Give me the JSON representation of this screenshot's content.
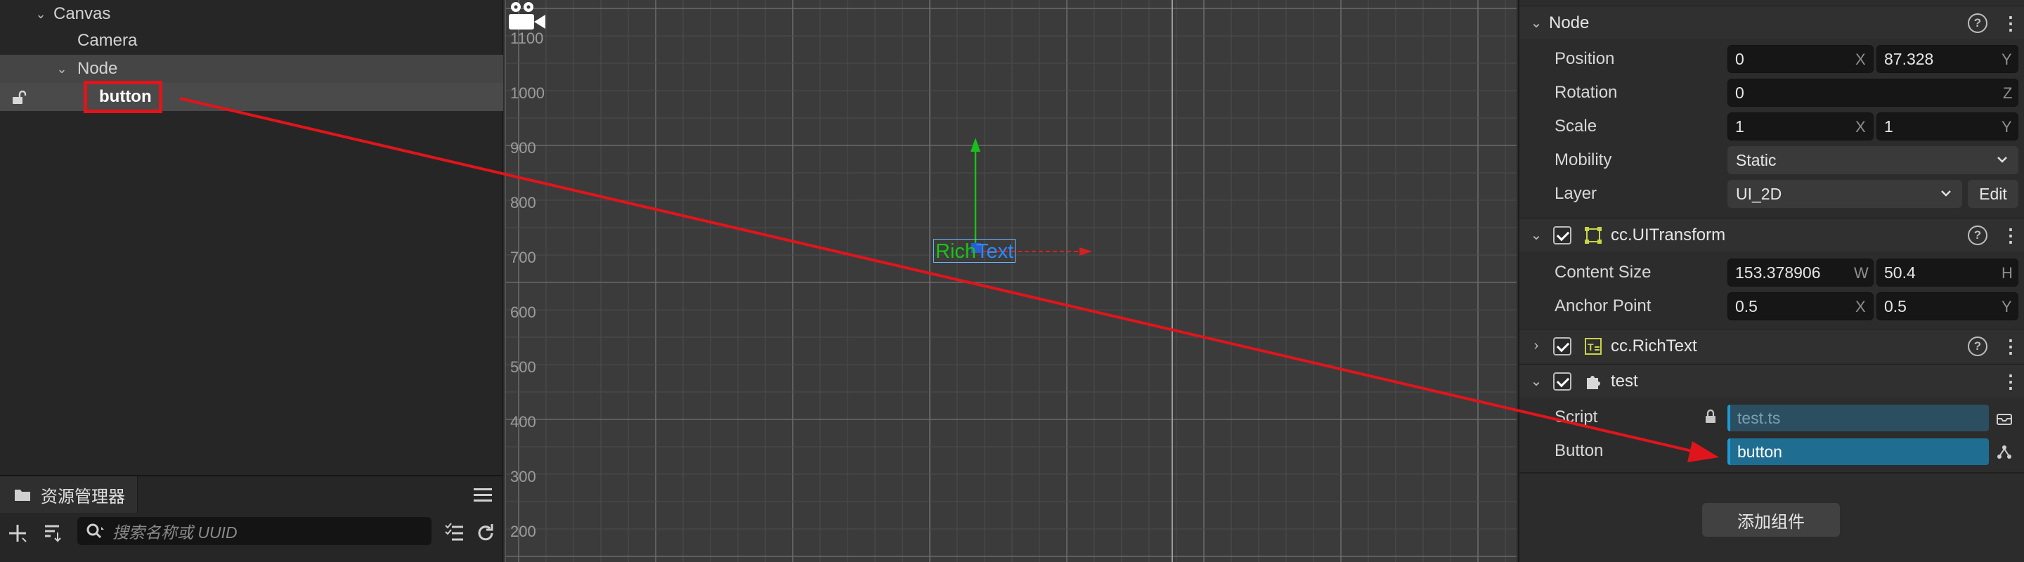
{
  "hierarchy": {
    "nodes": [
      "Canvas",
      "Camera",
      "Node",
      "button"
    ]
  },
  "assets": {
    "tab_label": "资源管理器",
    "search_placeholder": "搜索名称或 UUID"
  },
  "scene": {
    "y_labels": [
      "1100",
      "1000",
      "900",
      "800",
      "700",
      "600",
      "500",
      "400",
      "300",
      "200"
    ],
    "richtext_a": "Rich",
    "richtext_b": "Text"
  },
  "inspector": {
    "node": {
      "title": "Node",
      "position_label": "Position",
      "position_x": "0",
      "position_y": "87.328",
      "rotation_label": "Rotation",
      "rotation_z": "0",
      "scale_label": "Scale",
      "scale_x": "1",
      "scale_y": "1",
      "mobility_label": "Mobility",
      "mobility_value": "Static",
      "layer_label": "Layer",
      "layer_value": "UI_2D",
      "edit_label": "Edit",
      "axis_x": "X",
      "axis_y": "Y",
      "axis_z": "Z"
    },
    "uitransform": {
      "title": "cc.UITransform",
      "content_size_label": "Content Size",
      "width": "153.378906",
      "height": "50.4",
      "anchor_label": "Anchor Point",
      "anchor_x": "0.5",
      "anchor_y": "0.5",
      "axis_w": "W",
      "axis_h": "H",
      "axis_x": "X",
      "axis_y": "Y"
    },
    "richtext": {
      "title": "cc.RichText"
    },
    "test": {
      "title": "test",
      "script_label": "Script",
      "script_value": "test.ts",
      "button_label": "Button",
      "button_value": "button"
    },
    "add_component": "添加组件"
  },
  "colors": {
    "annotation_red": "#e0151b",
    "asset_field_blue": "#1f6e92",
    "accent_blue": "#1e9ad8",
    "gizmo_green": "#19c019",
    "gizmo_red": "#d62020"
  },
  "icons": [
    "lock-icon",
    "folder-icon",
    "hamburger-menu-icon",
    "add-icon",
    "sort-icon",
    "search-icon",
    "list-filter-icon",
    "refresh-icon",
    "camera-icon",
    "help-icon",
    "kebab-menu-icon",
    "transform-icon",
    "richtext-icon",
    "script-component-icon",
    "padlock-icon",
    "asset-locate-icon",
    "node-pick-icon",
    "chevron-down-icon"
  ]
}
